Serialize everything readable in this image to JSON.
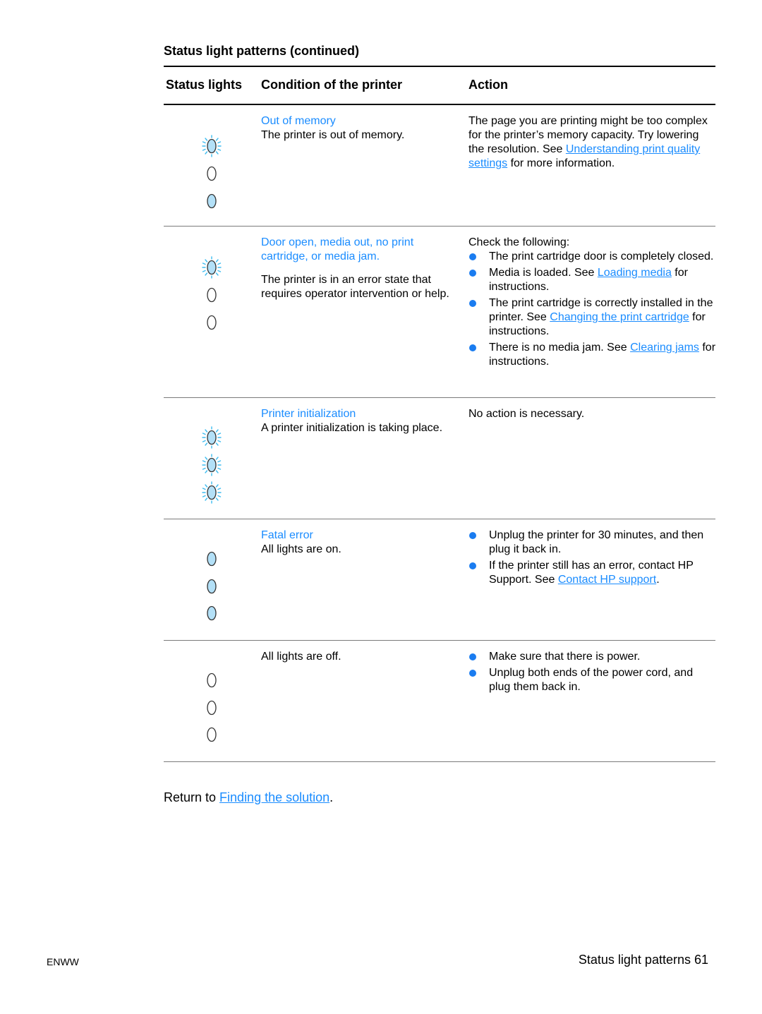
{
  "section_title": "Status light patterns (continued)",
  "table": {
    "headers": {
      "status_lights": "Status lights",
      "condition": "Condition of the printer",
      "action": "Action"
    },
    "rows": [
      {
        "lights": [
          "blinking",
          "off",
          "on"
        ],
        "condition_title": "Out of memory",
        "condition_desc": "The printer is out of memory.",
        "action": {
          "text_before": "The page you are printing might be too complex for the printer’s memory capacity. Try lowering the resolution. See ",
          "link": "Understanding print quality settings",
          "text_after": " for more information."
        }
      },
      {
        "lights": [
          "blinking",
          "off",
          "off"
        ],
        "condition_title": "Door open, media out, no print cartridge, or media jam.",
        "condition_desc": "The printer is in an error state that requires operator intervention or help.",
        "action": {
          "intro": "Check the following:",
          "bullets": [
            {
              "text": "The print cartridge door is completely closed."
            },
            {
              "text_before": "Media is loaded. See ",
              "link": "Loading media",
              "text_after": " for instructions."
            },
            {
              "text_before": "The print cartridge is correctly installed in the printer. See ",
              "link": "Changing the print cartridge",
              "text_after": " for instructions."
            },
            {
              "text_before": "There is no media jam. See ",
              "link": "Clearing jams",
              "text_after": " for instructions."
            }
          ]
        }
      },
      {
        "lights": [
          "blinking",
          "blinking",
          "blinking"
        ],
        "condition_title": "Printer initialization",
        "condition_desc": "A printer initialization is taking place.",
        "action": {
          "text": "No action is necessary."
        }
      },
      {
        "lights": [
          "on",
          "on",
          "on"
        ],
        "condition_title": "Fatal error",
        "condition_desc": "All lights are on.",
        "action": {
          "bullets": [
            {
              "text": "Unplug the printer for 30 minutes, and then plug it back in."
            },
            {
              "text_before": "If the printer still has an error, contact HP Support. See ",
              "link": "Contact HP support",
              "text_after": "."
            }
          ]
        }
      },
      {
        "lights": [
          "off",
          "off",
          "off"
        ],
        "condition_title": "",
        "condition_desc": "All lights are off.",
        "action": {
          "bullets": [
            {
              "text": "Make sure that there is power."
            },
            {
              "text": "Unplug both ends of the power cord, and plug them back in."
            }
          ]
        }
      }
    ]
  },
  "return": {
    "text": "Return to ",
    "link": "Finding the solution",
    "suffix": "."
  },
  "footer": {
    "left": "ENWW",
    "right": "Status light patterns 61"
  },
  "colors": {
    "link": "#1a8cff",
    "light_fill": "#b3e0f7",
    "light_rays": "#3dbcf0",
    "bullet": "#1a7cf0"
  }
}
